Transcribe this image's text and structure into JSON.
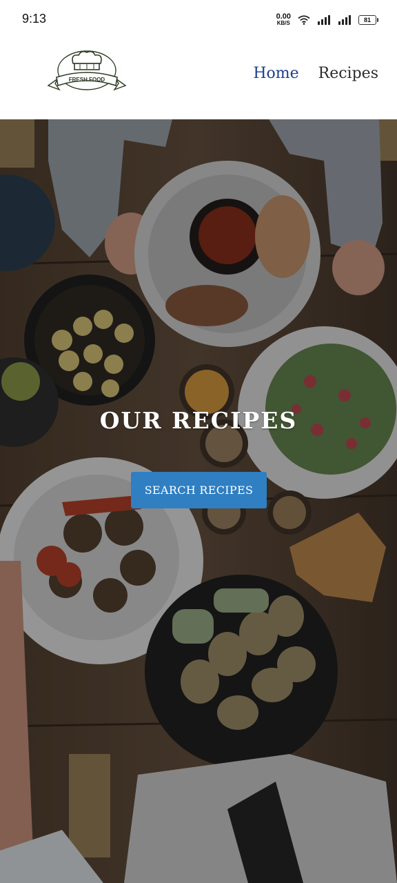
{
  "status_bar": {
    "time": "9:13",
    "net_speed_value": "0.00",
    "net_speed_unit": "KB/S",
    "battery": "81",
    "icons": [
      "wifi-icon",
      "signal-icon",
      "signal-icon",
      "battery-icon"
    ]
  },
  "header": {
    "logo_text": "FRESH FOOD",
    "nav": [
      {
        "label": "Home",
        "active": true
      },
      {
        "label": "Recipes",
        "active": false
      }
    ],
    "active_color": "#1b3f8c"
  },
  "hero": {
    "title": "OUR RECIPES",
    "button_label": "SEARCH RECIPES",
    "button_color": "#2f7fc2"
  }
}
